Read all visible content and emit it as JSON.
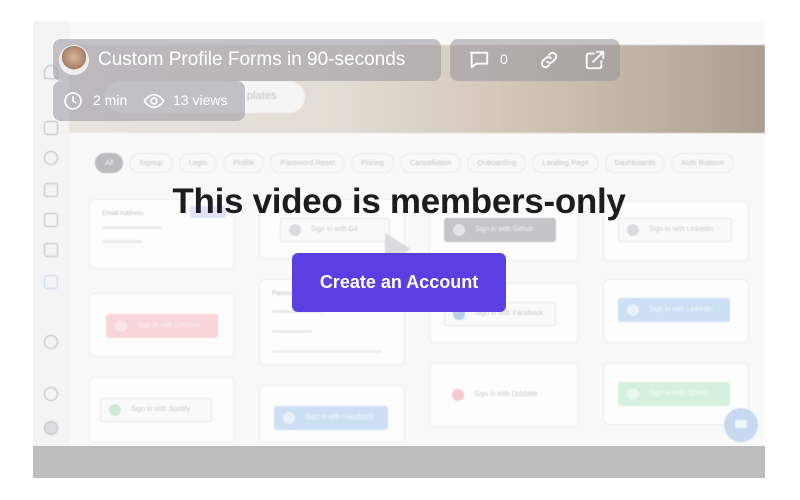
{
  "video": {
    "title": "Custom Profile Forms in 90-seconds",
    "comment_count": "0",
    "duration": "2 min",
    "views": "13 views"
  },
  "gate": {
    "heading": "This video is members-only",
    "cta_label": "Create an Account"
  },
  "background_app": {
    "banner_button_label": "plates",
    "filters": [
      "All",
      "Signup",
      "Login",
      "Profile",
      "Password Reset",
      "Pricing",
      "Cancellation",
      "Onboarding",
      "Landing Page",
      "Dashboards",
      "Auth Buttons"
    ],
    "active_filter": "All",
    "form_labels": {
      "email_address": "Email Address",
      "password": "Password"
    },
    "buttons": {
      "github_1": "Sign in with Git",
      "github_2": "Sign in with Github",
      "linkedin_1": "Sign in with LinkedIn",
      "linkedin_2": "Sign in with LinkedIn",
      "dribbble_1": "Sign in with Dribbble",
      "dribbble_2": "Sign in with Dribbble",
      "facebook_1": "Sign in with Facebook",
      "facebook_2": "Sign in with Facebook",
      "spotify_1": "Sign in with Spotify",
      "spotify_2": "Sign in with Spotify"
    }
  },
  "colors": {
    "accent": "#5b3fe3",
    "overlay_pill": "#96969c"
  },
  "icons": {
    "title": "avatar",
    "comment": "comment-icon",
    "link": "link-icon",
    "external": "external-link-icon",
    "clock": "clock-icon",
    "eye": "eye-icon"
  }
}
